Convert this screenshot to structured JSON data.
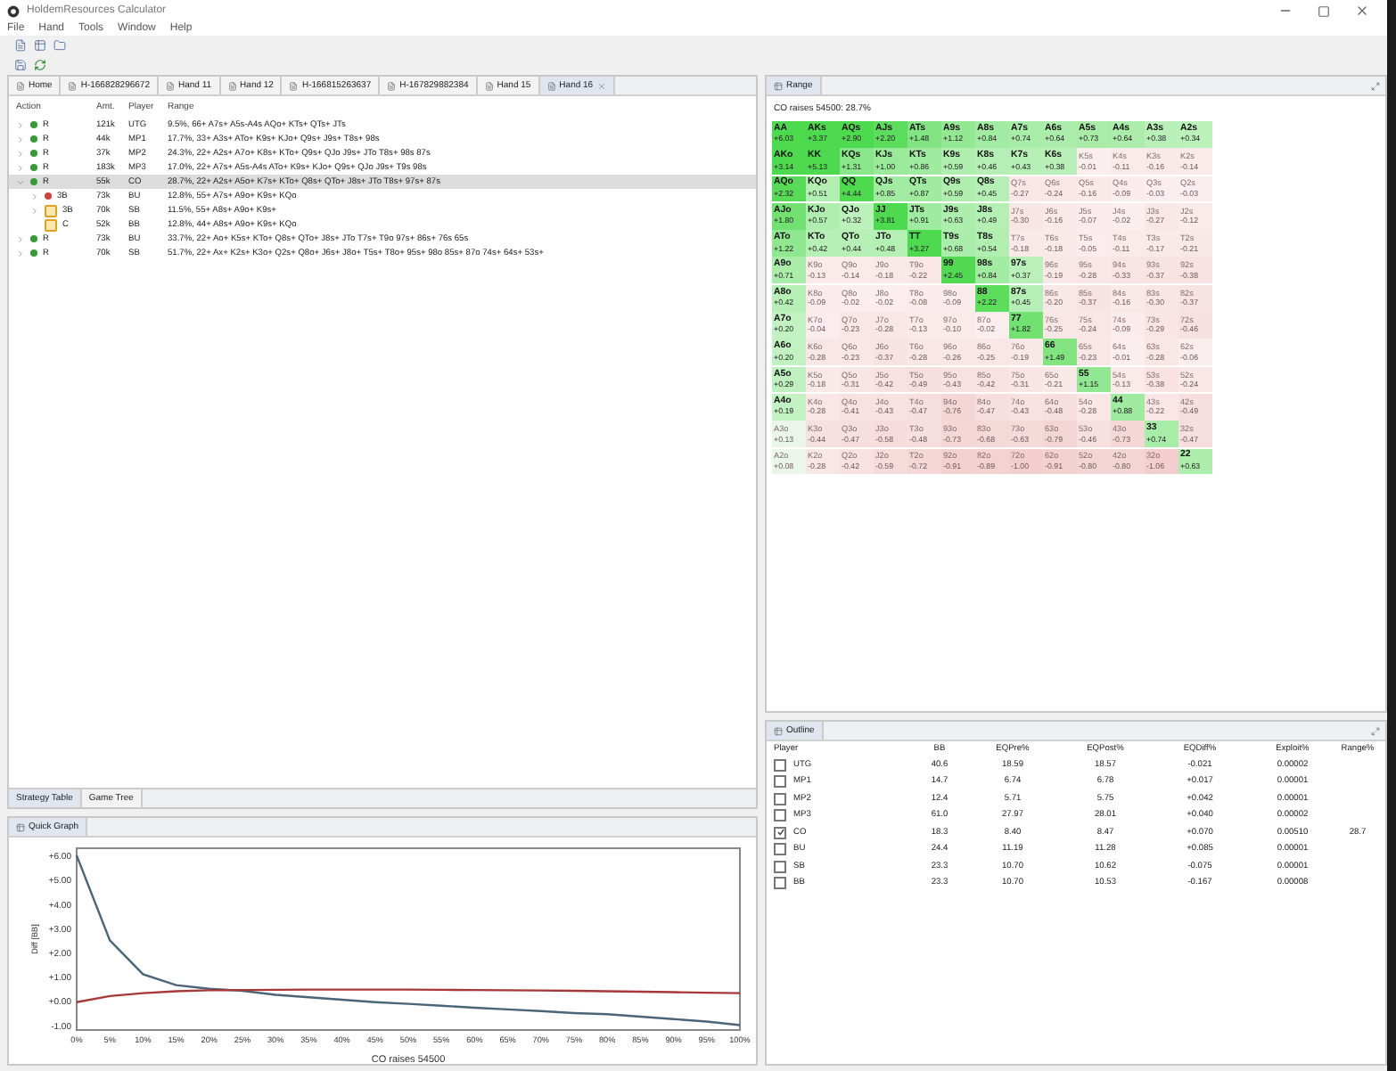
{
  "window": {
    "title": "HoldemResources Calculator"
  },
  "menu": [
    "File",
    "Hand",
    "Tools",
    "Window",
    "Help"
  ],
  "editor_tabs": [
    {
      "label": "Home",
      "selected": false
    },
    {
      "label": "H-166828296672",
      "selected": false
    },
    {
      "label": "Hand 11",
      "selected": false
    },
    {
      "label": "Hand 12",
      "selected": false
    },
    {
      "label": "H-166815263637",
      "selected": false
    },
    {
      "label": "H-167829882384",
      "selected": false
    },
    {
      "label": "Hand 15",
      "selected": false
    },
    {
      "label": "Hand 16",
      "selected": true
    }
  ],
  "tree": {
    "columns": [
      "Action",
      "Amt.",
      "Player",
      "Range"
    ],
    "rows": [
      {
        "action": "R",
        "amount": "121k",
        "player": "UTG",
        "range": "9.5%, 66+ A7s+ A5s-A4s AQo+ KTs+ QTs+ JTs",
        "color": "#3a9a3a",
        "kind": "dot",
        "selected": false,
        "expanded": false
      },
      {
        "action": "R",
        "amount": "44k",
        "player": "MP1",
        "range": "17.7%, 33+ A3s+ ATo+ K9s+ KJo+ Q9s+ J9s+ T8s+ 98s",
        "color": "#3a9a3a",
        "kind": "dot",
        "selected": false,
        "expanded": false
      },
      {
        "action": "R",
        "amount": "37k",
        "player": "MP2",
        "range": "24.3%, 22+ A2s+ A7o+ K8s+ KTo+ Q9s+ QJo J9s+ JTo T8s+ 98s 87s",
        "color": "#3a9a3a",
        "kind": "dot",
        "selected": false,
        "expanded": false
      },
      {
        "action": "R",
        "amount": "183k",
        "player": "MP3",
        "range": "17.0%, 22+ A7s+ A5s-A4s ATo+ K9s+ KJo+ Q9s+ QJo J9s+ T9s 98s",
        "color": "#3a9a3a",
        "kind": "dot",
        "selected": false,
        "expanded": false
      },
      {
        "action": "R",
        "amount": "55k",
        "player": "CO",
        "range": "28.7%, 22+ A2s+ A5o+ K7s+ KTo+ Q8s+ QTo+ J8s+ JTo T8s+ 97s+ 87s",
        "color": "#3a9a3a",
        "kind": "dot",
        "selected": true,
        "expanded": true,
        "children": [
          {
            "action": "3B",
            "amount": "73k",
            "player": "BU",
            "range": "12.8%, 55+ A7s+ A9o+ K9s+ KQo",
            "color": "#d04040",
            "kind": "dot",
            "expanded": false
          },
          {
            "action": "3B",
            "amount": "70k",
            "player": "SB",
            "range": "11.5%, 55+ A8s+ A9o+ K9s+",
            "color": "#e0a020",
            "kind": "chip",
            "expanded": false
          },
          {
            "action": "C",
            "amount": "52k",
            "player": "BB",
            "range": "12.8%, 44+ A8s+ A9o+ K9s+ KQo",
            "color": "#e0a020",
            "kind": "leaf-chip"
          }
        ]
      },
      {
        "action": "R",
        "amount": "73k",
        "player": "BU",
        "range": "33.7%, 22+ Ao+ K5s+ KTo+ Q8s+ QTo+ J8s+ JTo T7s+ T9o 97s+ 86s+ 76s 65s",
        "color": "#3a9a3a",
        "kind": "dot",
        "selected": false,
        "expanded": false
      },
      {
        "action": "R",
        "amount": "70k",
        "player": "SB",
        "range": "51.7%, 22+ Ax+ K2s+ K3o+ Q2s+ Q8o+ J6s+ J8o+ T5s+ T8o+ 95s+ 98o 85s+ 87o 74s+ 64s+ 53s+",
        "color": "#3a9a3a",
        "kind": "dot",
        "selected": false,
        "expanded": false
      }
    ]
  },
  "bottom_tabs": [
    {
      "label": "Strategy Table",
      "selected": true
    },
    {
      "label": "Game Tree",
      "selected": false
    }
  ],
  "quick_graph": {
    "title": "Quick Graph",
    "chart_data": {
      "type": "line",
      "xlabel": "CO raises 54500",
      "ylabel": "Diff [BB]",
      "x": [
        0,
        5,
        10,
        15,
        20,
        25,
        30,
        35,
        40,
        45,
        50,
        55,
        60,
        65,
        70,
        75,
        80,
        85,
        90,
        95,
        100
      ],
      "series": [
        {
          "color": "#4a6478",
          "values": [
            6.0,
            2.5,
            1.1,
            0.65,
            0.5,
            0.42,
            0.25,
            0.15,
            0.05,
            -0.05,
            -0.12,
            -0.2,
            -0.28,
            -0.35,
            -0.42,
            -0.5,
            -0.55,
            -0.65,
            -0.75,
            -0.85,
            -1.0
          ]
        },
        {
          "color": "#a83838",
          "values": [
            -0.05,
            0.2,
            0.32,
            0.4,
            0.44,
            0.45,
            0.46,
            0.47,
            0.47,
            0.47,
            0.47,
            0.46,
            0.45,
            0.44,
            0.43,
            0.42,
            0.4,
            0.38,
            0.36,
            0.34,
            0.32
          ]
        }
      ],
      "xlim": [
        0,
        100
      ],
      "ylim": [
        -1.2,
        6.3
      ],
      "xticks": [
        {
          "value": 0,
          "label": "0%"
        },
        {
          "value": 5,
          "label": "5%"
        },
        {
          "value": 10,
          "label": "10%"
        },
        {
          "value": 15,
          "label": "15%"
        },
        {
          "value": 20,
          "label": "20%"
        },
        {
          "value": 25,
          "label": "25%"
        },
        {
          "value": 30,
          "label": "30%"
        },
        {
          "value": 35,
          "label": "35%"
        },
        {
          "value": 40,
          "label": "40%"
        },
        {
          "value": 45,
          "label": "45%"
        },
        {
          "value": 50,
          "label": "50%"
        },
        {
          "value": 55,
          "label": "55%"
        },
        {
          "value": 60,
          "label": "60%"
        },
        {
          "value": 65,
          "label": "65%"
        },
        {
          "value": 70,
          "label": "70%"
        },
        {
          "value": 75,
          "label": "75%"
        },
        {
          "value": 80,
          "label": "80%"
        },
        {
          "value": 85,
          "label": "85%"
        },
        {
          "value": 90,
          "label": "90%"
        },
        {
          "value": 95,
          "label": "95%"
        },
        {
          "value": 100,
          "label": "100%"
        }
      ],
      "yticks": [
        {
          "value": 6,
          "label": "+6.00"
        },
        {
          "value": 5,
          "label": "+5.00"
        },
        {
          "value": 4,
          "label": "+4.00"
        },
        {
          "value": 3,
          "label": "+3.00"
        },
        {
          "value": 2,
          "label": "+2.00"
        },
        {
          "value": 1,
          "label": "+1.00"
        },
        {
          "value": 0,
          "label": "+0.00"
        },
        {
          "value": -1,
          "label": "-1.00"
        }
      ]
    }
  },
  "range_panel": {
    "title": "Range",
    "caption": "CO raises 54500: 28.7%",
    "grid": [
      [
        {
          "hand": "AA",
          "ev": "+6.03",
          "selected": true
        },
        {
          "hand": "AKs",
          "ev": "+3.37",
          "selected": true
        },
        {
          "hand": "AQs",
          "ev": "+2.90",
          "selected": true
        },
        {
          "hand": "AJs",
          "ev": "+2.20",
          "selected": true
        },
        {
          "hand": "ATs",
          "ev": "+1.48",
          "selected": true
        },
        {
          "hand": "A9s",
          "ev": "+1.12",
          "selected": true
        },
        {
          "hand": "A8s",
          "ev": "+0.84",
          "selected": true
        },
        {
          "hand": "A7s",
          "ev": "+0.74",
          "selected": true
        },
        {
          "hand": "A6s",
          "ev": "+0.64",
          "selected": true
        },
        {
          "hand": "A5s",
          "ev": "+0.73",
          "selected": true
        },
        {
          "hand": "A4s",
          "ev": "+0.64",
          "selected": true
        },
        {
          "hand": "A3s",
          "ev": "+0.38",
          "selected": true
        },
        {
          "hand": "A2s",
          "ev": "+0.34",
          "selected": true
        }
      ],
      [
        {
          "hand": "AKo",
          "ev": "+3.14",
          "selected": true
        },
        {
          "hand": "KK",
          "ev": "+5.13",
          "selected": true
        },
        {
          "hand": "KQs",
          "ev": "+1.31",
          "selected": true
        },
        {
          "hand": "KJs",
          "ev": "+1.00",
          "selected": true
        },
        {
          "hand": "KTs",
          "ev": "+0.86",
          "selected": true
        },
        {
          "hand": "K9s",
          "ev": "+0.59",
          "selected": true
        },
        {
          "hand": "K8s",
          "ev": "+0.46",
          "selected": true
        },
        {
          "hand": "K7s",
          "ev": "+0.43",
          "selected": true
        },
        {
          "hand": "K6s",
          "ev": "+0.38",
          "selected": true
        },
        {
          "hand": "K5s",
          "ev": "-0.01",
          "selected": false
        },
        {
          "hand": "K4s",
          "ev": "-0.11",
          "selected": false
        },
        {
          "hand": "K3s",
          "ev": "-0.16",
          "selected": false
        },
        {
          "hand": "K2s",
          "ev": "-0.14",
          "selected": false
        }
      ],
      [
        {
          "hand": "AQo",
          "ev": "+2.32",
          "selected": true
        },
        {
          "hand": "KQo",
          "ev": "+0.51",
          "selected": true
        },
        {
          "hand": "QQ",
          "ev": "+4.44",
          "selected": true
        },
        {
          "hand": "QJs",
          "ev": "+0.85",
          "selected": true
        },
        {
          "hand": "QTs",
          "ev": "+0.87",
          "selected": true
        },
        {
          "hand": "Q9s",
          "ev": "+0.59",
          "selected": true
        },
        {
          "hand": "Q8s",
          "ev": "+0.45",
          "selected": true
        },
        {
          "hand": "Q7s",
          "ev": "-0.27",
          "selected": false
        },
        {
          "hand": "Q6s",
          "ev": "-0.24",
          "selected": false
        },
        {
          "hand": "Q5s",
          "ev": "-0.16",
          "selected": false
        },
        {
          "hand": "Q4s",
          "ev": "-0.09",
          "selected": false
        },
        {
          "hand": "Q3s",
          "ev": "-0.03",
          "selected": false
        },
        {
          "hand": "Q2s",
          "ev": "-0.03",
          "selected": false
        }
      ],
      [
        {
          "hand": "AJo",
          "ev": "+1.80",
          "selected": true
        },
        {
          "hand": "KJo",
          "ev": "+0.57",
          "selected": true
        },
        {
          "hand": "QJo",
          "ev": "+0.32",
          "selected": true
        },
        {
          "hand": "JJ",
          "ev": "+3.81",
          "selected": true
        },
        {
          "hand": "JTs",
          "ev": "+0.91",
          "selected": true
        },
        {
          "hand": "J9s",
          "ev": "+0.63",
          "selected": true
        },
        {
          "hand": "J8s",
          "ev": "+0.49",
          "selected": true
        },
        {
          "hand": "J7s",
          "ev": "-0.30",
          "selected": false
        },
        {
          "hand": "J6s",
          "ev": "-0.16",
          "selected": false
        },
        {
          "hand": "J5s",
          "ev": "-0.07",
          "selected": false
        },
        {
          "hand": "J4s",
          "ev": "-0.02",
          "selected": false
        },
        {
          "hand": "J3s",
          "ev": "-0.27",
          "selected": false
        },
        {
          "hand": "J2s",
          "ev": "-0.12",
          "selected": false
        }
      ],
      [
        {
          "hand": "ATo",
          "ev": "+1.22",
          "selected": true
        },
        {
          "hand": "KTo",
          "ev": "+0.42",
          "selected": true
        },
        {
          "hand": "QTo",
          "ev": "+0.44",
          "selected": true
        },
        {
          "hand": "JTo",
          "ev": "+0.48",
          "selected": true
        },
        {
          "hand": "TT",
          "ev": "+3.27",
          "selected": true
        },
        {
          "hand": "T9s",
          "ev": "+0.68",
          "selected": true
        },
        {
          "hand": "T8s",
          "ev": "+0.54",
          "selected": true
        },
        {
          "hand": "T7s",
          "ev": "-0.18",
          "selected": false
        },
        {
          "hand": "T6s",
          "ev": "-0.18",
          "selected": false
        },
        {
          "hand": "T5s",
          "ev": "-0.05",
          "selected": false
        },
        {
          "hand": "T4s",
          "ev": "-0.11",
          "selected": false
        },
        {
          "hand": "T3s",
          "ev": "-0.17",
          "selected": false
        },
        {
          "hand": "T2s",
          "ev": "-0.21",
          "selected": false
        }
      ],
      [
        {
          "hand": "A9o",
          "ev": "+0.71",
          "selected": true
        },
        {
          "hand": "K9o",
          "ev": "-0.13",
          "selected": false
        },
        {
          "hand": "Q9o",
          "ev": "-0.14",
          "selected": false
        },
        {
          "hand": "J9o",
          "ev": "-0.18",
          "selected": false
        },
        {
          "hand": "T9o",
          "ev": "-0.22",
          "selected": false
        },
        {
          "hand": "99",
          "ev": "+2.45",
          "selected": true
        },
        {
          "hand": "98s",
          "ev": "+0.84",
          "selected": true
        },
        {
          "hand": "97s",
          "ev": "+0.37",
          "selected": true
        },
        {
          "hand": "96s",
          "ev": "-0.19",
          "selected": false
        },
        {
          "hand": "95s",
          "ev": "-0.28",
          "selected": false
        },
        {
          "hand": "94s",
          "ev": "-0.33",
          "selected": false
        },
        {
          "hand": "93s",
          "ev": "-0.37",
          "selected": false
        },
        {
          "hand": "92s",
          "ev": "-0.38",
          "selected": false
        }
      ],
      [
        {
          "hand": "A8o",
          "ev": "+0.42",
          "selected": true
        },
        {
          "hand": "K8o",
          "ev": "-0.09",
          "selected": false
        },
        {
          "hand": "Q8o",
          "ev": "-0.02",
          "selected": false
        },
        {
          "hand": "J8o",
          "ev": "-0.02",
          "selected": false
        },
        {
          "hand": "T8o",
          "ev": "-0.08",
          "selected": false
        },
        {
          "hand": "98o",
          "ev": "-0.09",
          "selected": false
        },
        {
          "hand": "88",
          "ev": "+2.22",
          "selected": true
        },
        {
          "hand": "87s",
          "ev": "+0.45",
          "selected": true
        },
        {
          "hand": "86s",
          "ev": "-0.20",
          "selected": false
        },
        {
          "hand": "85s",
          "ev": "-0.37",
          "selected": false
        },
        {
          "hand": "84s",
          "ev": "-0.16",
          "selected": false
        },
        {
          "hand": "83s",
          "ev": "-0.30",
          "selected": false
        },
        {
          "hand": "82s",
          "ev": "-0.37",
          "selected": false
        }
      ],
      [
        {
          "hand": "A7o",
          "ev": "+0.20",
          "selected": true
        },
        {
          "hand": "K7o",
          "ev": "-0.04",
          "selected": false
        },
        {
          "hand": "Q7o",
          "ev": "-0.23",
          "selected": false
        },
        {
          "hand": "J7o",
          "ev": "-0.28",
          "selected": false
        },
        {
          "hand": "T7o",
          "ev": "-0.13",
          "selected": false
        },
        {
          "hand": "97o",
          "ev": "-0.10",
          "selected": false
        },
        {
          "hand": "87o",
          "ev": "-0.02",
          "selected": false
        },
        {
          "hand": "77",
          "ev": "+1.82",
          "selected": true
        },
        {
          "hand": "76s",
          "ev": "-0.25",
          "selected": false
        },
        {
          "hand": "75s",
          "ev": "-0.24",
          "selected": false
        },
        {
          "hand": "74s",
          "ev": "-0.09",
          "selected": false
        },
        {
          "hand": "73s",
          "ev": "-0.29",
          "selected": false
        },
        {
          "hand": "72s",
          "ev": "-0.46",
          "selected": false
        }
      ],
      [
        {
          "hand": "A6o",
          "ev": "+0.20",
          "selected": true
        },
        {
          "hand": "K6o",
          "ev": "-0.28",
          "selected": false
        },
        {
          "hand": "Q6o",
          "ev": "-0.23",
          "selected": false
        },
        {
          "hand": "J6o",
          "ev": "-0.37",
          "selected": false
        },
        {
          "hand": "T6o",
          "ev": "-0.28",
          "selected": false
        },
        {
          "hand": "96o",
          "ev": "-0.26",
          "selected": false
        },
        {
          "hand": "86o",
          "ev": "-0.25",
          "selected": false
        },
        {
          "hand": "76o",
          "ev": "-0.19",
          "selected": false
        },
        {
          "hand": "66",
          "ev": "+1.49",
          "selected": true
        },
        {
          "hand": "65s",
          "ev": "-0.23",
          "selected": false
        },
        {
          "hand": "64s",
          "ev": "-0.01",
          "selected": false
        },
        {
          "hand": "63s",
          "ev": "-0.28",
          "selected": false
        },
        {
          "hand": "62s",
          "ev": "-0.06",
          "selected": false
        }
      ],
      [
        {
          "hand": "A5o",
          "ev": "+0.29",
          "selected": true
        },
        {
          "hand": "K5o",
          "ev": "-0.18",
          "selected": false
        },
        {
          "hand": "Q5o",
          "ev": "-0.31",
          "selected": false
        },
        {
          "hand": "J5o",
          "ev": "-0.42",
          "selected": false
        },
        {
          "hand": "T5o",
          "ev": "-0.49",
          "selected": false
        },
        {
          "hand": "95o",
          "ev": "-0.43",
          "selected": false
        },
        {
          "hand": "85o",
          "ev": "-0.42",
          "selected": false
        },
        {
          "hand": "75o",
          "ev": "-0.31",
          "selected": false
        },
        {
          "hand": "65o",
          "ev": "-0.21",
          "selected": false
        },
        {
          "hand": "55",
          "ev": "+1.15",
          "selected": true
        },
        {
          "hand": "54s",
          "ev": "-0.13",
          "selected": false
        },
        {
          "hand": "53s",
          "ev": "-0.38",
          "selected": false
        },
        {
          "hand": "52s",
          "ev": "-0.24",
          "selected": false
        }
      ],
      [
        {
          "hand": "A4o",
          "ev": "+0.19",
          "selected": true
        },
        {
          "hand": "K4o",
          "ev": "-0.28",
          "selected": false
        },
        {
          "hand": "Q4o",
          "ev": "-0.41",
          "selected": false
        },
        {
          "hand": "J4o",
          "ev": "-0.43",
          "selected": false
        },
        {
          "hand": "T4o",
          "ev": "-0.47",
          "selected": false
        },
        {
          "hand": "94o",
          "ev": "-0.76",
          "selected": false
        },
        {
          "hand": "84o",
          "ev": "-0.47",
          "selected": false
        },
        {
          "hand": "74o",
          "ev": "-0.43",
          "selected": false
        },
        {
          "hand": "64o",
          "ev": "-0.48",
          "selected": false
        },
        {
          "hand": "54o",
          "ev": "-0.28",
          "selected": false
        },
        {
          "hand": "44",
          "ev": "+0.88",
          "selected": true
        },
        {
          "hand": "43s",
          "ev": "-0.22",
          "selected": false
        },
        {
          "hand": "42s",
          "ev": "-0.49",
          "selected": false
        }
      ],
      [
        {
          "hand": "A3o",
          "ev": "+0.13",
          "selected": false
        },
        {
          "hand": "K3o",
          "ev": "-0.44",
          "selected": false
        },
        {
          "hand": "Q3o",
          "ev": "-0.47",
          "selected": false
        },
        {
          "hand": "J3o",
          "ev": "-0.58",
          "selected": false
        },
        {
          "hand": "T3o",
          "ev": "-0.48",
          "selected": false
        },
        {
          "hand": "93o",
          "ev": "-0.73",
          "selected": false
        },
        {
          "hand": "83o",
          "ev": "-0.68",
          "selected": false
        },
        {
          "hand": "73o",
          "ev": "-0.63",
          "selected": false
        },
        {
          "hand": "63o",
          "ev": "-0.79",
          "selected": false
        },
        {
          "hand": "53o",
          "ev": "-0.46",
          "selected": false
        },
        {
          "hand": "43o",
          "ev": "-0.73",
          "selected": false
        },
        {
          "hand": "33",
          "ev": "+0.74",
          "selected": true
        },
        {
          "hand": "32s",
          "ev": "-0.47",
          "selected": false
        }
      ],
      [
        {
          "hand": "A2o",
          "ev": "+0.08",
          "selected": false
        },
        {
          "hand": "K2o",
          "ev": "-0.28",
          "selected": false
        },
        {
          "hand": "Q2o",
          "ev": "-0.42",
          "selected": false
        },
        {
          "hand": "J2o",
          "ev": "-0.59",
          "selected": false
        },
        {
          "hand": "T2o",
          "ev": "-0.72",
          "selected": false
        },
        {
          "hand": "92o",
          "ev": "-0.91",
          "selected": false
        },
        {
          "hand": "82o",
          "ev": "-0.89",
          "selected": false
        },
        {
          "hand": "72o",
          "ev": "-1.00",
          "selected": false
        },
        {
          "hand": "62o",
          "ev": "-0.91",
          "selected": false
        },
        {
          "hand": "52o",
          "ev": "-0.80",
          "selected": false
        },
        {
          "hand": "42o",
          "ev": "-0.80",
          "selected": false
        },
        {
          "hand": "32o",
          "ev": "-1.06",
          "selected": false
        },
        {
          "hand": "22",
          "ev": "+0.63",
          "selected": true
        }
      ]
    ]
  },
  "outline": {
    "title": "Outline",
    "columns": [
      "Player",
      "BB",
      "EQPre%",
      "EQPost%",
      "EQDiff%",
      "Exploit%",
      "Range%"
    ],
    "rows": [
      {
        "checked": false,
        "cells": [
          "UTG",
          "40.6",
          "18.59",
          "18.57",
          "-0.021",
          "0.00002"
        ]
      },
      {
        "checked": false,
        "cells": [
          "MP1",
          "14.7",
          "6.74",
          "6.78",
          "+0.017",
          "0.00001"
        ]
      },
      {
        "checked": false,
        "cells": [
          "MP2",
          "12.4",
          "5.71",
          "5.75",
          "+0.042",
          "0.00001"
        ]
      },
      {
        "checked": false,
        "cells": [
          "MP3",
          "61.0",
          "27.97",
          "28.01",
          "+0.040",
          "0.00002"
        ]
      },
      {
        "checked": true,
        "cells": [
          "CO",
          "18.3",
          "8.40",
          "8.47",
          "+0.070",
          "0.00510",
          "28.7"
        ]
      },
      {
        "checked": false,
        "cells": [
          "BU",
          "24.4",
          "11.19",
          "11.28",
          "+0.085",
          "0.00001"
        ]
      },
      {
        "checked": false,
        "cells": [
          "SB",
          "23.3",
          "10.70",
          "10.62",
          "-0.075",
          "0.00001"
        ]
      },
      {
        "checked": false,
        "cells": [
          "BB",
          "23.3",
          "10.70",
          "10.53",
          "-0.167",
          "0.00008"
        ]
      }
    ]
  }
}
